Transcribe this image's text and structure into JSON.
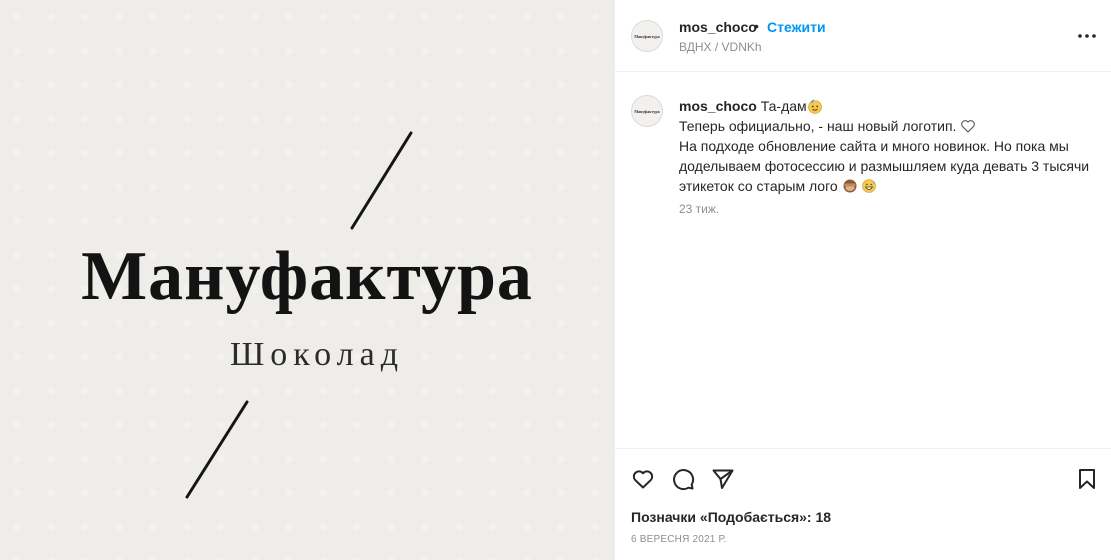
{
  "image": {
    "logo_main": "Мануфактура",
    "logo_sub": "Шоколад",
    "background_color": "#efedea"
  },
  "header": {
    "username": "mos_choco",
    "separator": "•",
    "follow_label": "Стежити",
    "location": "ВДНХ / VDNKh",
    "avatar_text": "Мануфактура",
    "more_icon": "more-horizontal-icon"
  },
  "caption": {
    "username": "mos_choco",
    "line1": "Та-дам",
    "line2": "Теперь официально, - наш новый логотип.",
    "line3": "На подходе обновление сайта и много новинок. Но пока мы",
    "line4": "доделываем фотосессию и размышляем куда девать 3 тысячи",
    "line5": "этикеток со старым лого",
    "time": "23 тиж."
  },
  "actions": {
    "like_icon": "heart-icon",
    "comment_icon": "comment-icon",
    "share_icon": "paper-plane-icon",
    "save_icon": "bookmark-icon"
  },
  "likes": {
    "label": "Позначки «Подобається»:",
    "count": "18"
  },
  "post_date": "6 ВЕРЕСНЯ 2021 Р.",
  "colors": {
    "link": "#0095f6",
    "muted": "#8e8e8e",
    "text": "#262626",
    "border": "#efefef"
  }
}
